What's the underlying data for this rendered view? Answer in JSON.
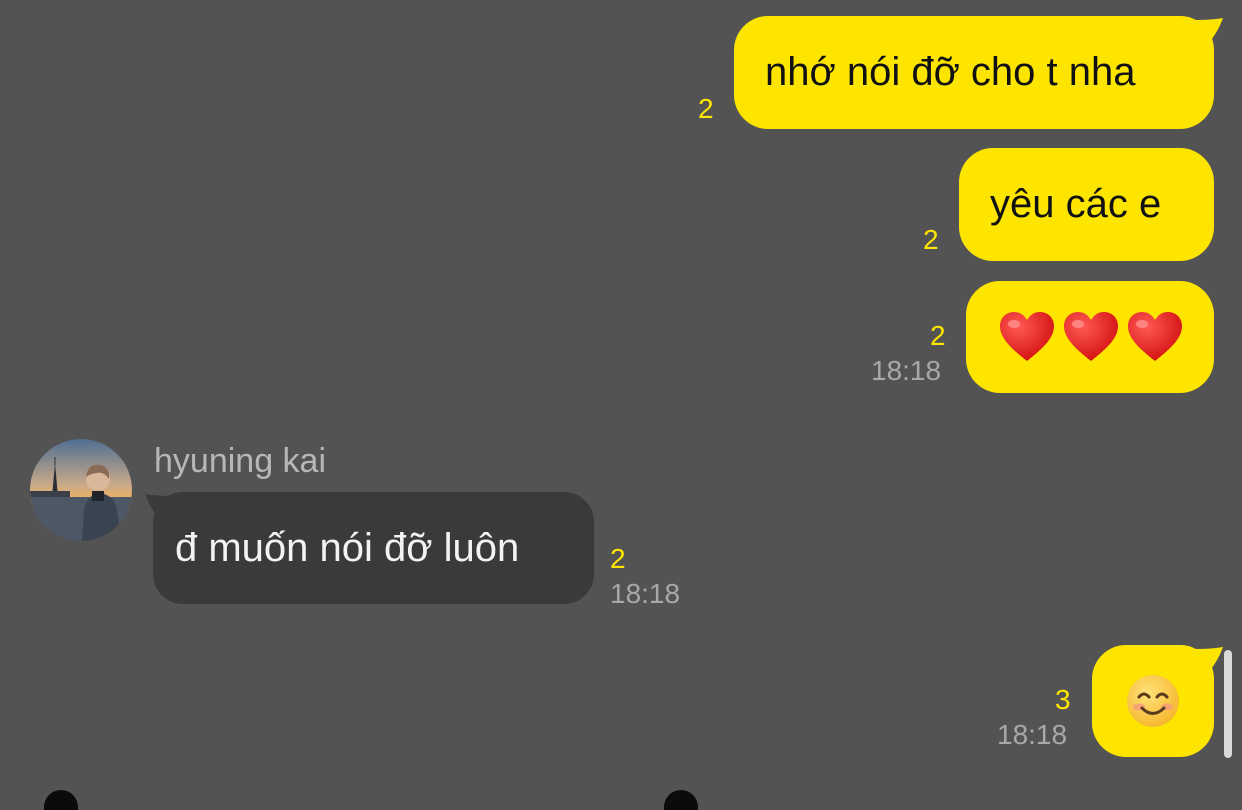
{
  "colors": {
    "background": "#545354",
    "my_bubble": "#fee500",
    "other_bubble": "#3b3a3b",
    "unread_count": "#fee500",
    "timestamp": "#a9a8a9"
  },
  "messages": [
    {
      "text": "nhớ nói đỡ cho t nha",
      "unread": "2",
      "time": ""
    },
    {
      "text": "yêu các e",
      "unread": "2",
      "time": ""
    },
    {
      "emoji": [
        "heart-icon",
        "heart-icon",
        "heart-icon"
      ],
      "unread": "2",
      "time": "18:18"
    },
    {
      "sender": "hyuning kai",
      "text": "đ muốn nói đỡ luôn",
      "unread": "2",
      "time": "18:18"
    },
    {
      "emoji": [
        "smiling-face-icon"
      ],
      "unread": "3",
      "time": "18:18"
    }
  ]
}
